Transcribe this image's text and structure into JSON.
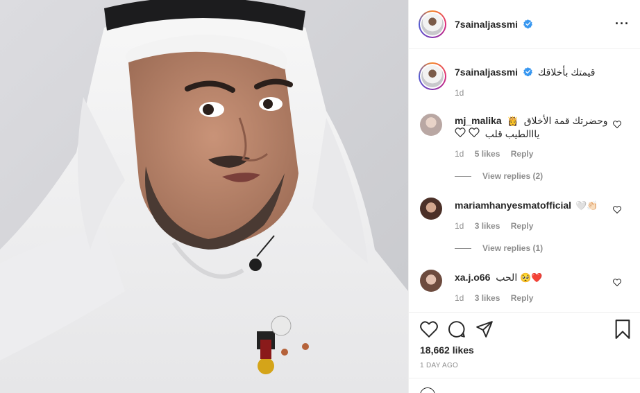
{
  "post": {
    "author": "7sainaljassmi",
    "caption": "قيمتك بأخلاقك",
    "caption_age": "1d",
    "likes": "18,662 likes",
    "date": "1 DAY AGO",
    "more_icon": "more-horizontal-icon"
  },
  "comments": [
    {
      "user": "mj_malika",
      "line1": "وحضرتك قمة الأخلاق",
      "emoji": "👸",
      "line2": "يااالطيب قلب",
      "age": "1d",
      "likes": "5 likes",
      "reply": "Reply",
      "view_replies": "View replies (2)"
    },
    {
      "user": "mariamhanyesmatofficial",
      "text": "🤍👏🏻",
      "age": "1d",
      "likes": "3 likes",
      "reply": "Reply",
      "view_replies": "View replies (1)"
    },
    {
      "user": "xa.j.o66",
      "text": "الحب",
      "emoji": "🥺❤️",
      "age": "1d",
      "likes": "3 likes",
      "reply": "Reply"
    }
  ],
  "colors": {
    "verified": "#3897f0",
    "muted": "#8e8e8e",
    "text": "#262626",
    "border": "#efefef"
  }
}
